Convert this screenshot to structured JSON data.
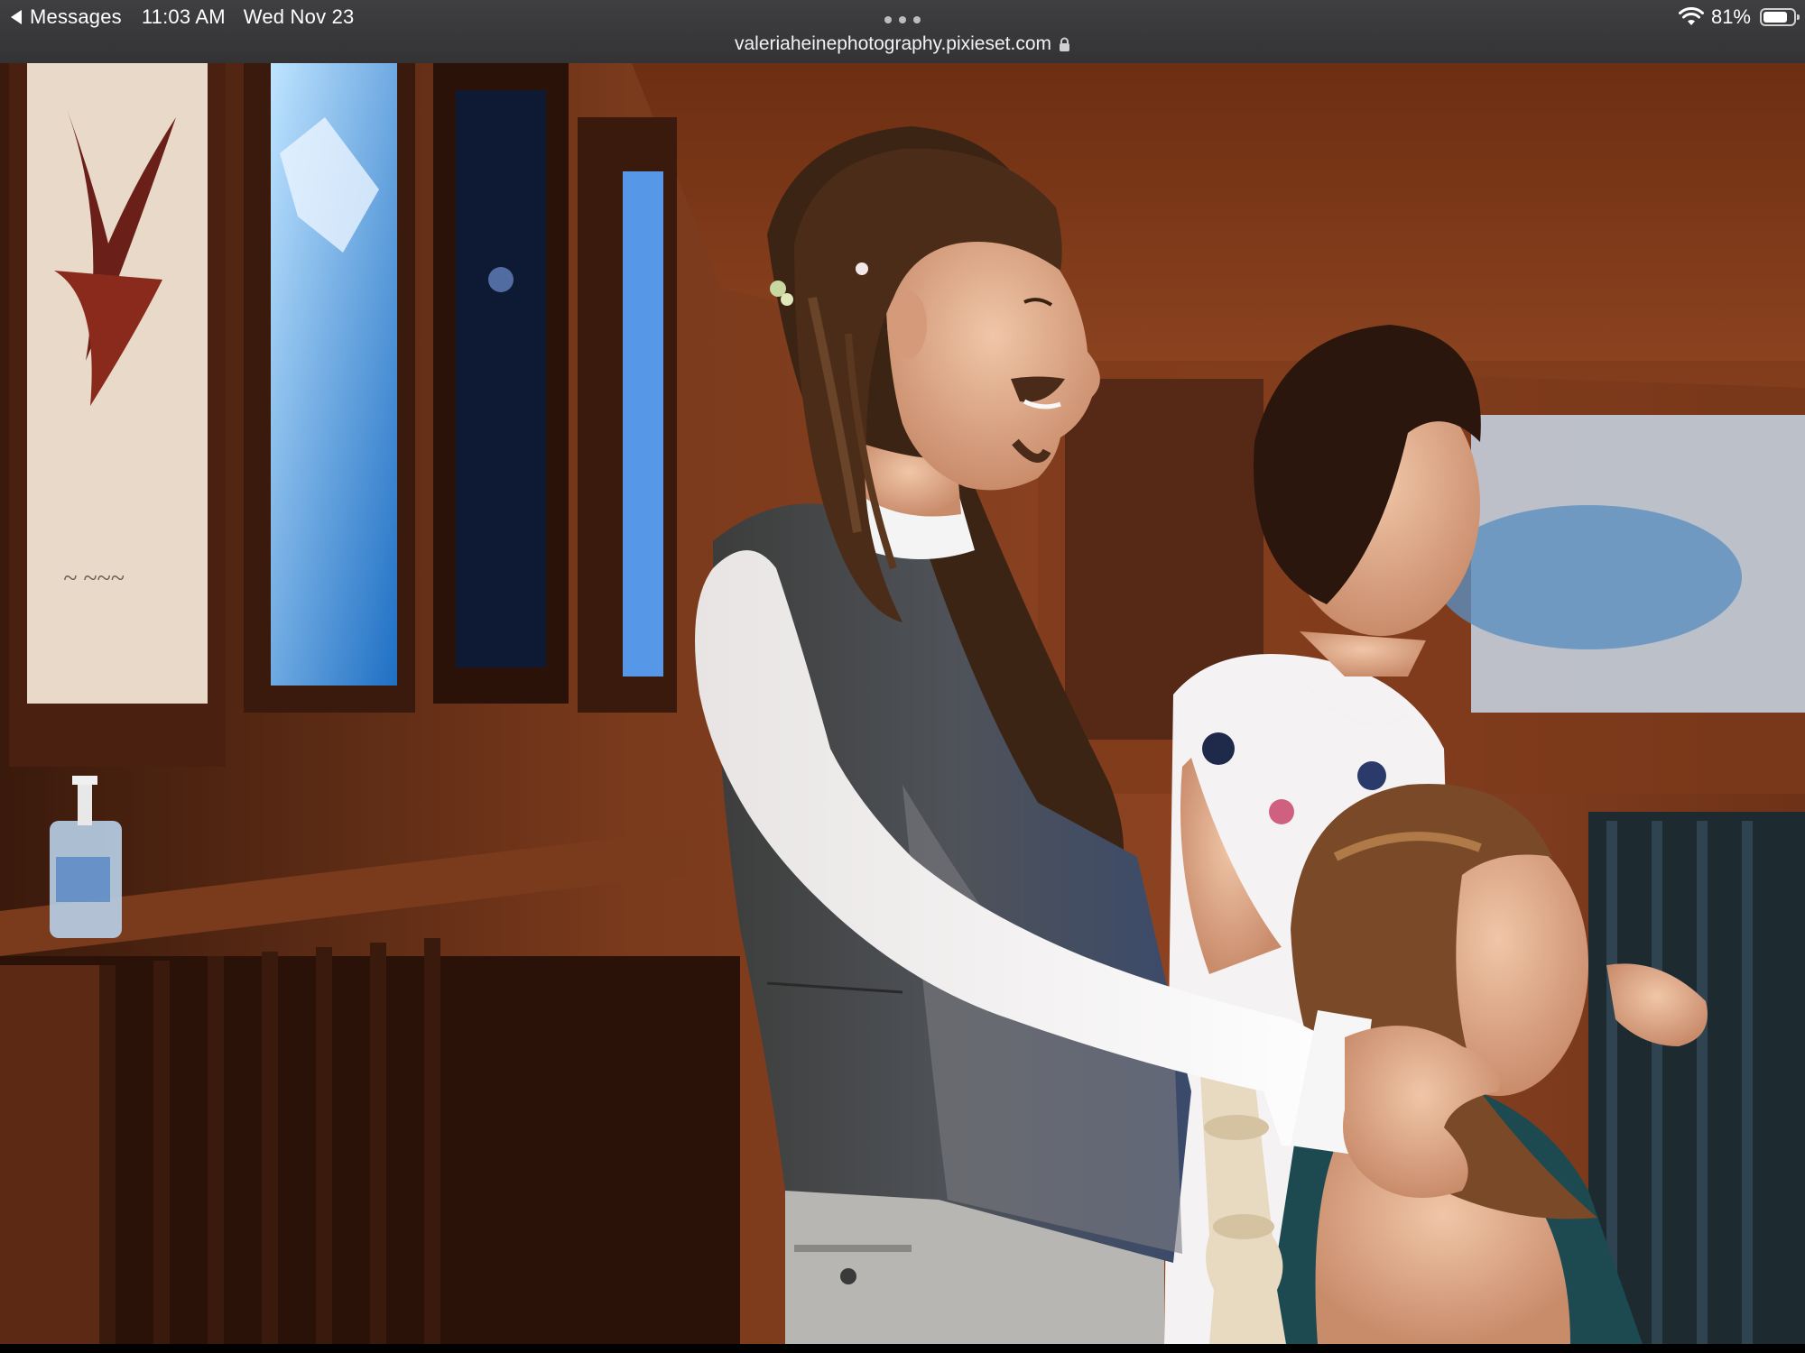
{
  "status_bar": {
    "back_label": "Messages",
    "time": "11:03 AM",
    "date": "Wed Nov 23",
    "wifi_icon": "wifi-icon",
    "battery_percent": 81,
    "battery_label": "81%"
  },
  "browser": {
    "url": "valeriaheinephotography.pixieset.com",
    "lock_icon": "lock-icon",
    "more_icon": "more-dots-icon"
  }
}
